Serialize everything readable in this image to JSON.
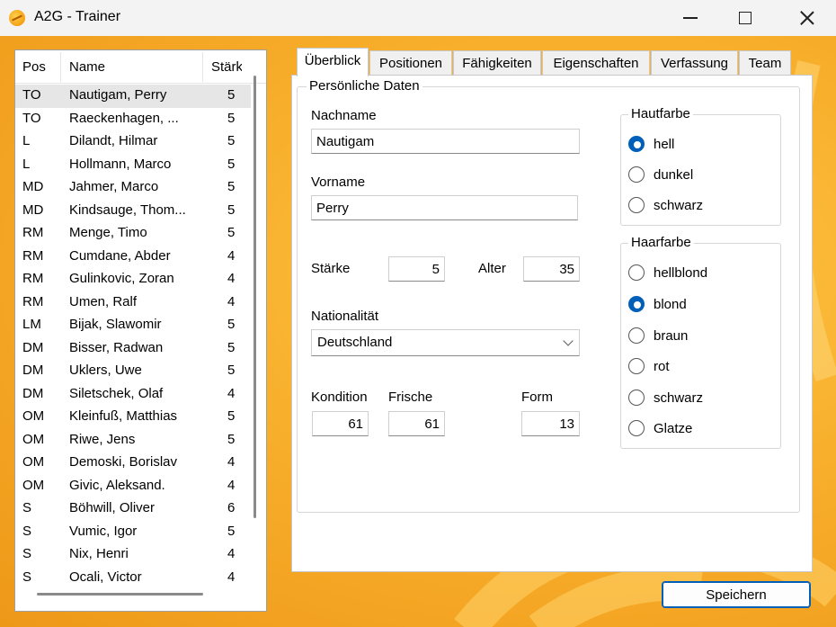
{
  "window": {
    "title": "A2G - Trainer"
  },
  "player_list": {
    "columns": [
      "Pos",
      "Name",
      "Stärke"
    ],
    "rows": [
      {
        "pos": "TO",
        "name": "Nautigam, Perry",
        "strength": "5",
        "selected": true
      },
      {
        "pos": "TO",
        "name": "Raeckenhagen, ...",
        "strength": "5"
      },
      {
        "pos": "L",
        "name": "Dilandt, Hilmar",
        "strength": "5"
      },
      {
        "pos": "L",
        "name": "Hollmann, Marco",
        "strength": "5"
      },
      {
        "pos": "MD",
        "name": "Jahmer, Marco",
        "strength": "5"
      },
      {
        "pos": "MD",
        "name": "Kindsauge, Thom...",
        "strength": "5"
      },
      {
        "pos": "RM",
        "name": "Menge, Timo",
        "strength": "5"
      },
      {
        "pos": "RM",
        "name": "Cumdane, Abder",
        "strength": "4"
      },
      {
        "pos": "RM",
        "name": "Gulinkovic, Zoran",
        "strength": "4"
      },
      {
        "pos": "RM",
        "name": "Umen, Ralf",
        "strength": "4"
      },
      {
        "pos": "LM",
        "name": "Bijak, Slawomir",
        "strength": "5"
      },
      {
        "pos": "DM",
        "name": "Bisser, Radwan",
        "strength": "5"
      },
      {
        "pos": "DM",
        "name": "Uklers, Uwe",
        "strength": "5"
      },
      {
        "pos": "DM",
        "name": "Siletschek, Olaf",
        "strength": "4"
      },
      {
        "pos": "OM",
        "name": "Kleinfuß, Matthias",
        "strength": "5"
      },
      {
        "pos": "OM",
        "name": "Riwe, Jens",
        "strength": "5"
      },
      {
        "pos": "OM",
        "name": "Demoski, Borislav",
        "strength": "4"
      },
      {
        "pos": "OM",
        "name": "Givic, Aleksand.",
        "strength": "4"
      },
      {
        "pos": "S",
        "name": "Böhwill, Oliver",
        "strength": "6"
      },
      {
        "pos": "S",
        "name": "Vumic, Igor",
        "strength": "5"
      },
      {
        "pos": "S",
        "name": "Nix, Henri",
        "strength": "4"
      },
      {
        "pos": "S",
        "name": "Ocali, Victor",
        "strength": "4"
      }
    ]
  },
  "tabs": [
    {
      "label": "Überblick",
      "active": true
    },
    {
      "label": "Positionen"
    },
    {
      "label": "Fähigkeiten"
    },
    {
      "label": "Eigenschaften"
    },
    {
      "label": "Verfassung"
    },
    {
      "label": "Team"
    }
  ],
  "personal": {
    "group_title": "Persönliche Daten",
    "lastname_label": "Nachname",
    "lastname_value": "Nautigam",
    "firstname_label": "Vorname",
    "firstname_value": "Perry",
    "strength_label": "Stärke",
    "strength_value": "5",
    "age_label": "Alter",
    "age_value": "35",
    "nationality_label": "Nationalität",
    "nationality_value": "Deutschland",
    "condition_label": "Kondition",
    "condition_value": "61",
    "freshness_label": "Frische",
    "freshness_value": "61",
    "form_label": "Form",
    "form_value": "13"
  },
  "skin": {
    "title": "Hautfarbe",
    "options": [
      "hell",
      "dunkel",
      "schwarz"
    ],
    "selected": "hell"
  },
  "hair": {
    "title": "Haarfarbe",
    "options": [
      "hellblond",
      "blond",
      "braun",
      "rot",
      "schwarz",
      "Glatze"
    ],
    "selected": "blond"
  },
  "actions": {
    "save_label": "Speichern"
  },
  "colors": {
    "accent": "#005fb8",
    "background_orange": "#f8b02c"
  }
}
